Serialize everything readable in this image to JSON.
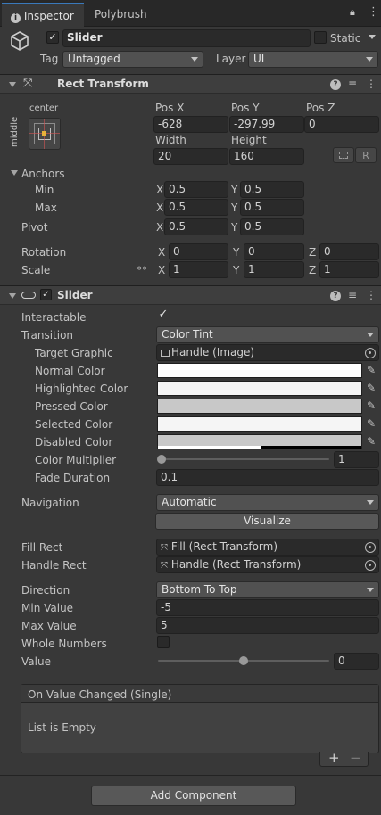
{
  "tabs": {
    "inspector": "Inspector",
    "polybrush": "Polybrush"
  },
  "object": {
    "name": "Slider",
    "static_label": "Static",
    "tag_label": "Tag",
    "tag_value": "Untagged",
    "layer_label": "Layer",
    "layer_value": "UI"
  },
  "rect_transform": {
    "title": "Rect Transform",
    "anchor_preset_top": "center",
    "anchor_preset_side": "middle",
    "pos_x_label": "Pos X",
    "pos_y_label": "Pos Y",
    "pos_z_label": "Pos Z",
    "pos_x": "-628",
    "pos_y": "-297.99",
    "pos_z": "0",
    "width_label": "Width",
    "height_label": "Height",
    "width": "20",
    "height": "160",
    "r_button": "R",
    "anchors_label": "Anchors",
    "min_label": "Min",
    "max_label": "Max",
    "min_x": "0.5",
    "min_y": "0.5",
    "max_x": "0.5",
    "max_y": "0.5",
    "pivot_label": "Pivot",
    "pivot_x": "0.5",
    "pivot_y": "0.5",
    "rotation_label": "Rotation",
    "rot_x": "0",
    "rot_y": "0",
    "rot_z": "0",
    "scale_label": "Scale",
    "scale_x": "1",
    "scale_y": "1",
    "scale_z": "1",
    "x": "X",
    "y": "Y",
    "z": "Z"
  },
  "slider": {
    "title": "Slider",
    "interactable_label": "Interactable",
    "transition_label": "Transition",
    "transition_value": "Color Tint",
    "target_graphic_label": "Target Graphic",
    "target_graphic_value": "Handle (Image)",
    "normal_color_label": "Normal Color",
    "highlighted_color_label": "Highlighted Color",
    "pressed_color_label": "Pressed Color",
    "selected_color_label": "Selected Color",
    "disabled_color_label": "Disabled Color",
    "color_multiplier_label": "Color Multiplier",
    "color_multiplier_value": "1",
    "fade_duration_label": "Fade Duration",
    "fade_duration_value": "0.1",
    "navigation_label": "Navigation",
    "navigation_value": "Automatic",
    "visualize_button": "Visualize",
    "fill_rect_label": "Fill Rect",
    "fill_rect_value": "Fill (Rect Transform)",
    "handle_rect_label": "Handle Rect",
    "handle_rect_value": "Handle (Rect Transform)",
    "direction_label": "Direction",
    "direction_value": "Bottom To Top",
    "min_value_label": "Min Value",
    "min_value": "-5",
    "max_value_label": "Max Value",
    "max_value": "5",
    "whole_numbers_label": "Whole Numbers",
    "value_label": "Value",
    "value": "0",
    "event_title": "On Value Changed (Single)",
    "event_empty": "List is Empty",
    "colors": {
      "normal": "#ffffff",
      "highlighted": "#f5f5f5",
      "pressed": "#c8c8c8",
      "selected": "#f5f5f5",
      "disabled": "#c8c8c8"
    }
  },
  "add_component_button": "Add Component",
  "accent": "#3a79bb"
}
